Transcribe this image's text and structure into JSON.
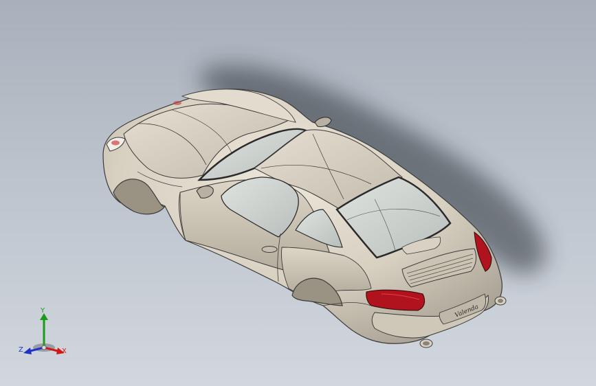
{
  "viewport": {
    "background_top": "#a9b0bb",
    "background_bottom": "#d2d7de"
  },
  "model": {
    "body_color": "#ddd6c8",
    "shadow_color": "#2c3038",
    "taillight_color": "#b0121e",
    "glass_color": "#cfd4d2",
    "edge_color": "#3a3a3a",
    "rear_badge": "Valenda"
  },
  "triad": {
    "x_label": "X",
    "y_label": "Y",
    "z_label": "Z",
    "x_color": "#d01818",
    "y_color": "#1c9a1c",
    "z_color": "#1f33c8"
  }
}
